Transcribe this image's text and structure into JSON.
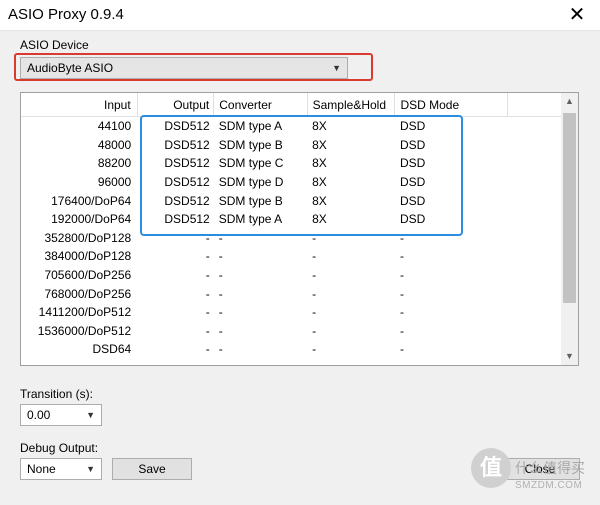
{
  "window": {
    "title": "ASIO Proxy 0.9.4",
    "close_glyph": "✕"
  },
  "device": {
    "label": "ASIO Device",
    "value": "AudioByte ASIO"
  },
  "table": {
    "headers": [
      "Input",
      "Output",
      "Converter",
      "Sample&Hold",
      "DSD Mode"
    ],
    "rows": [
      [
        "44100",
        "DSD512",
        "SDM type A",
        "8X",
        "DSD"
      ],
      [
        "48000",
        "DSD512",
        "SDM type B",
        "8X",
        "DSD"
      ],
      [
        "88200",
        "DSD512",
        "SDM type C",
        "8X",
        "DSD"
      ],
      [
        "96000",
        "DSD512",
        "SDM type D",
        "8X",
        "DSD"
      ],
      [
        "176400/DoP64",
        "DSD512",
        "SDM type B",
        "8X",
        "DSD"
      ],
      [
        "192000/DoP64",
        "DSD512",
        "SDM type A",
        "8X",
        "DSD"
      ],
      [
        "352800/DoP128",
        "-",
        "-",
        "-",
        "-"
      ],
      [
        "384000/DoP128",
        "-",
        "-",
        "-",
        "-"
      ],
      [
        "705600/DoP256",
        "-",
        "-",
        "-",
        "-"
      ],
      [
        "768000/DoP256",
        "-",
        "-",
        "-",
        "-"
      ],
      [
        "1411200/DoP512",
        "-",
        "-",
        "-",
        "-"
      ],
      [
        "1536000/DoP512",
        "-",
        "-",
        "-",
        "-"
      ],
      [
        "DSD64",
        "-",
        "-",
        "-",
        "-"
      ]
    ]
  },
  "transition": {
    "label": "Transition (s):",
    "value": "0.00"
  },
  "debug": {
    "label": "Debug Output:",
    "value": "None"
  },
  "buttons": {
    "save": "Save",
    "close": "Close"
  },
  "watermark": {
    "glyph": "值",
    "text": "什么值得买",
    "site": "SMZDM.COM"
  },
  "colors": {
    "red_highlight": "#d83c2e",
    "blue_highlight": "#2b8de0"
  }
}
